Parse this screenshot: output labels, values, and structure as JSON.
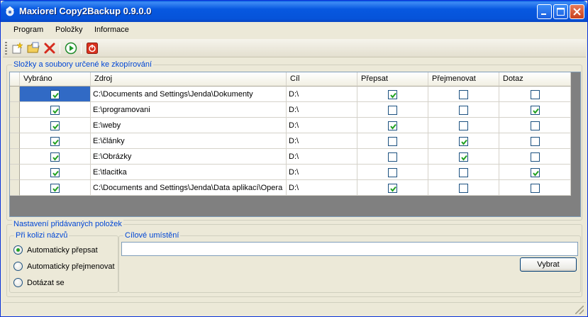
{
  "window": {
    "title": "Maxiorel Copy2Backup 0.9.0.0"
  },
  "menu": [
    {
      "label": "Program"
    },
    {
      "label": "Položky"
    },
    {
      "label": "Informace"
    }
  ],
  "toolbar": {
    "icons": [
      "new-item-icon",
      "open-folder-icon",
      "delete-icon",
      "run-icon",
      "power-icon"
    ]
  },
  "grid_group": {
    "legend": "Složky a soubory určené ke zkopírování",
    "columns": [
      "Vybráno",
      "Zdroj",
      "Cíl",
      "Přepsat",
      "Přejmenovat",
      "Dotaz"
    ],
    "rows": [
      {
        "selected": true,
        "source": "C:\\Documents and Settings\\Jenda\\Dokumenty",
        "target": "D:\\",
        "overwrite": true,
        "rename": false,
        "ask": false
      },
      {
        "selected": true,
        "source": "E:\\programovani",
        "target": "D:\\",
        "overwrite": false,
        "rename": false,
        "ask": true
      },
      {
        "selected": true,
        "source": "E:\\weby",
        "target": "D:\\",
        "overwrite": true,
        "rename": false,
        "ask": false
      },
      {
        "selected": true,
        "source": "E:\\články",
        "target": "D:\\",
        "overwrite": false,
        "rename": true,
        "ask": false
      },
      {
        "selected": true,
        "source": "E:\\Obrázky",
        "target": "D:\\",
        "overwrite": false,
        "rename": true,
        "ask": false
      },
      {
        "selected": true,
        "source": "E:\\tlacitka",
        "target": "D:\\",
        "overwrite": false,
        "rename": false,
        "ask": true
      },
      {
        "selected": true,
        "source": "C:\\Documents and Settings\\Jenda\\Data aplikací\\Opera",
        "target": "D:\\",
        "overwrite": true,
        "rename": false,
        "ask": false
      }
    ]
  },
  "settings_group": {
    "legend": "Nastavení přidávaných položek",
    "collision": {
      "legend": "Při kolizi názvů",
      "options": [
        "Automaticky přepsat",
        "Automaticky přejmenovat",
        "Dotázat se"
      ],
      "selected_index": 0
    },
    "destination": {
      "legend": "Cílové umístění",
      "value": "",
      "button_label": "Vybrat"
    }
  },
  "colors": {
    "title_bar": "#0758e0",
    "legend_text": "#0046d5",
    "selection": "#316ac5",
    "check": "#21a121"
  }
}
